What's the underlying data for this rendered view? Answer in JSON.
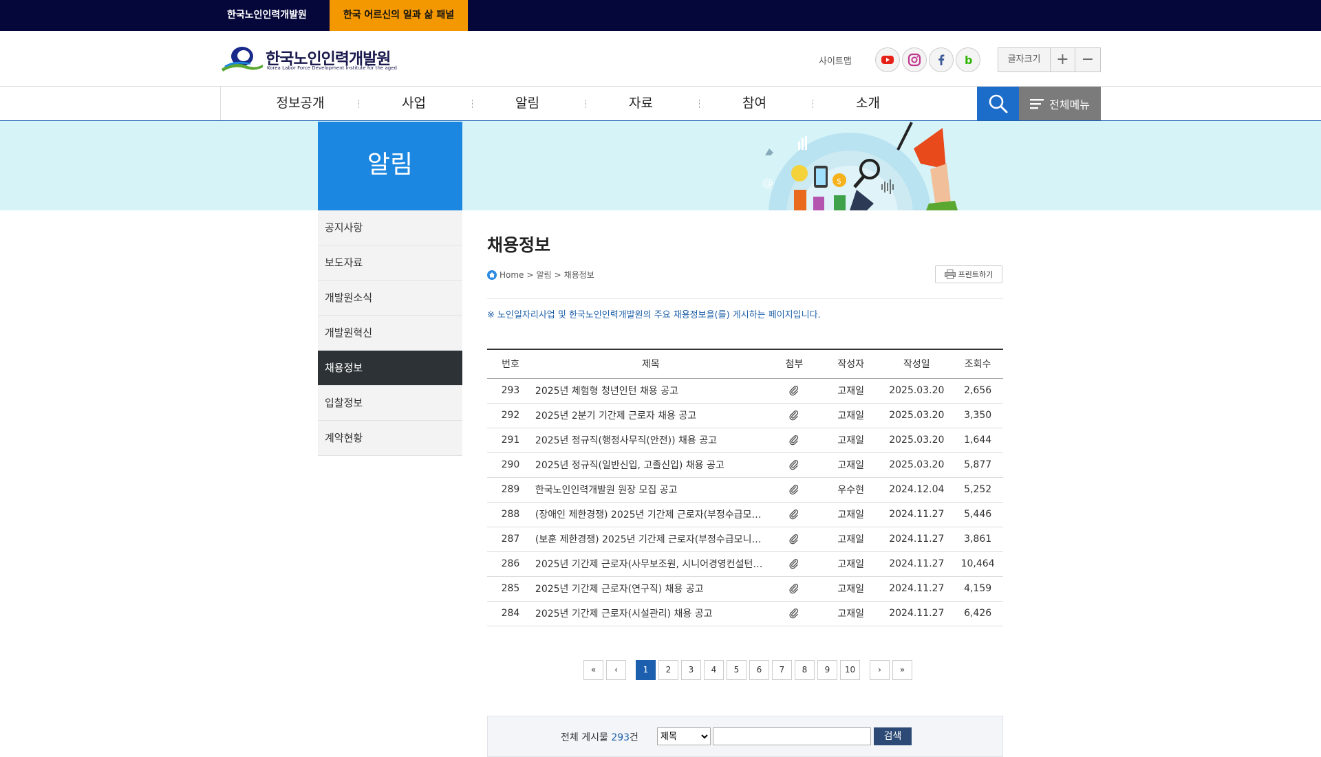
{
  "topbar": {
    "tab1": "한국노인인력개발원",
    "tab2": "한국 어르신의 일과 삶 패널"
  },
  "logo": {
    "name": "한국노인인력개발원",
    "sub": "Korea Labor Force Development Institute for the aged"
  },
  "header": {
    "sitemap": "사이트맵",
    "font_size_label": "글자크기",
    "font_plus": "+",
    "font_minus": "−"
  },
  "sns": [
    "youtube-icon",
    "instagram-icon",
    "facebook-icon",
    "blog-icon"
  ],
  "gnb": [
    "정보공개",
    "사업",
    "알림",
    "자료",
    "참여",
    "소개"
  ],
  "allmenu": "전체메뉴",
  "banner": {
    "title": "알림"
  },
  "lnb": [
    {
      "label": "공지사항",
      "active": false
    },
    {
      "label": "보도자료",
      "active": false
    },
    {
      "label": "개발원소식",
      "active": false
    },
    {
      "label": "개발원혁신",
      "active": false
    },
    {
      "label": "채용정보",
      "active": true
    },
    {
      "label": "입찰정보",
      "active": false
    },
    {
      "label": "계약현황",
      "active": false
    }
  ],
  "page": {
    "title": "채용정보",
    "breadcrumb": [
      "Home",
      "알림",
      "채용정보"
    ],
    "print": "프린트하기",
    "notice": "※ 노인일자리사업 및 한국노인인력개발원의 주요 채용정보을(를) 게시하는 페이지입니다."
  },
  "table": {
    "headers": [
      "번호",
      "제목",
      "첨부",
      "작성자",
      "작성일",
      "조회수"
    ],
    "rows": [
      {
        "no": "293",
        "title": "2025년 체험형 청년인턴 채용 공고",
        "writer": "고재일",
        "date": "2025.03.20",
        "views": "2,656"
      },
      {
        "no": "292",
        "title": "2025년 2분기 기간제 근로자 채용 공고",
        "writer": "고재일",
        "date": "2025.03.20",
        "views": "3,350"
      },
      {
        "no": "291",
        "title": "2025년 정규직(행정사무직(안전)) 채용 공고",
        "writer": "고재일",
        "date": "2025.03.20",
        "views": "1,644"
      },
      {
        "no": "290",
        "title": "2025년 정규직(일반신입, 고졸신입) 채용 공고",
        "writer": "고재일",
        "date": "2025.03.20",
        "views": "5,877"
      },
      {
        "no": "289",
        "title": "한국노인인력개발원 원장 모집 공고",
        "writer": "우수현",
        "date": "2024.12.04",
        "views": "5,252"
      },
      {
        "no": "288",
        "title": "(장애인 제한경쟁) 2025년 기간제 근로자(부정수급모니…",
        "writer": "고재일",
        "date": "2024.11.27",
        "views": "5,446"
      },
      {
        "no": "287",
        "title": "(보훈 제한경쟁) 2025년 기간제 근로자(부정수급모니터…",
        "writer": "고재일",
        "date": "2024.11.27",
        "views": "3,861"
      },
      {
        "no": "286",
        "title": "2025년 기간제 근로자(사무보조원, 시니어경영컨설턴트,…",
        "writer": "고재일",
        "date": "2024.11.27",
        "views": "10,464"
      },
      {
        "no": "285",
        "title": "2025년 기간제 근로자(연구직) 채용 공고",
        "writer": "고재일",
        "date": "2024.11.27",
        "views": "4,159"
      },
      {
        "no": "284",
        "title": "2025년 기간제 근로자(시설관리) 채용 공고",
        "writer": "고재일",
        "date": "2024.11.27",
        "views": "6,426"
      }
    ]
  },
  "pager": {
    "first": "«",
    "prev": "‹",
    "pages": [
      "1",
      "2",
      "3",
      "4",
      "5",
      "6",
      "7",
      "8",
      "9",
      "10"
    ],
    "current": "1",
    "next": "›",
    "last": "»"
  },
  "search": {
    "count_label": "전체 게시물",
    "count": "293",
    "count_unit": "건",
    "option": "제목",
    "button": "검색"
  }
}
